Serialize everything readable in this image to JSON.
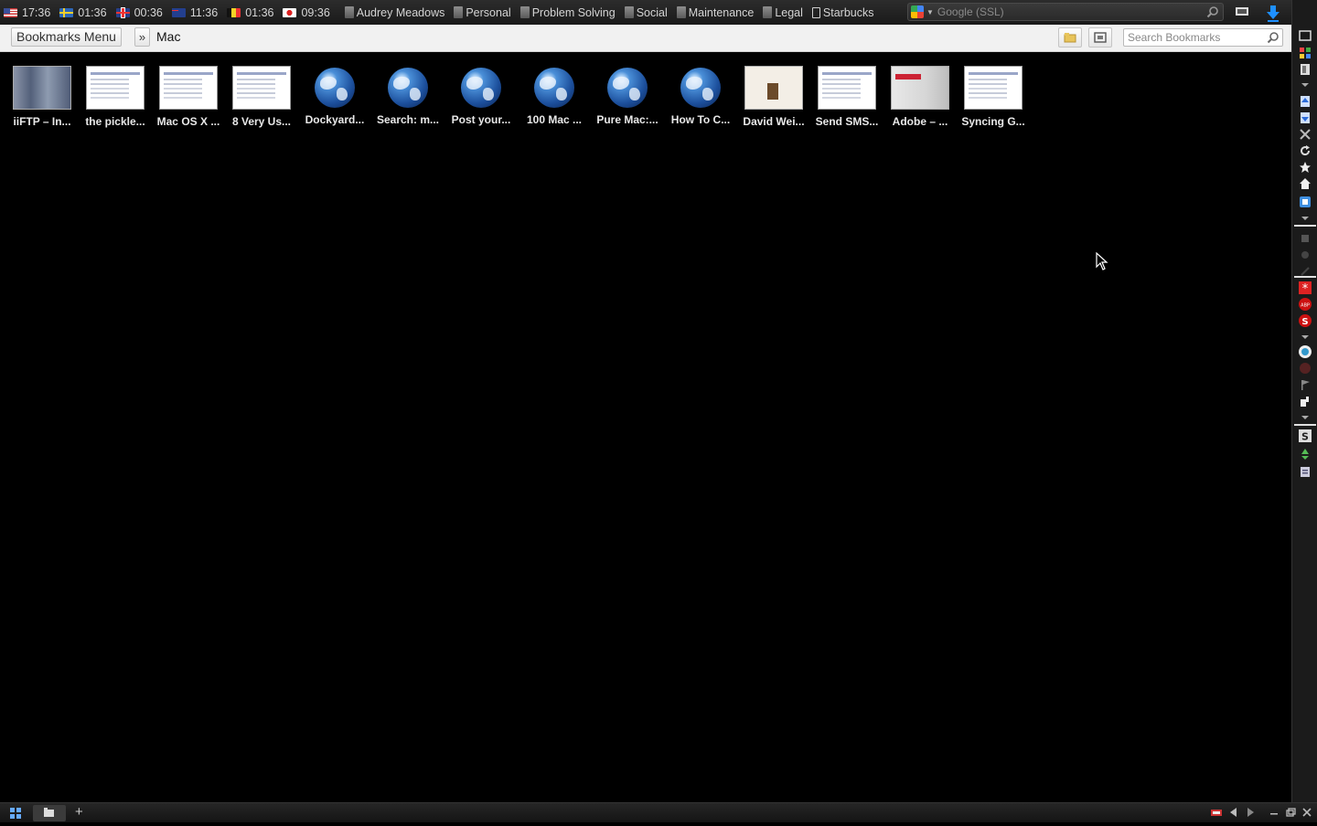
{
  "topbar": {
    "clocks": [
      {
        "flag": "us",
        "time": "17:36"
      },
      {
        "flag": "se",
        "time": "01:36"
      },
      {
        "flag": "uk",
        "time": "00:36"
      },
      {
        "flag": "au",
        "time": "11:36"
      },
      {
        "flag": "be",
        "time": "01:36"
      },
      {
        "flag": "jp",
        "time": "09:36"
      }
    ],
    "bookmarks": [
      "Audrey Meadows",
      "Personal",
      "Problem Solving",
      "Social",
      "Maintenance",
      "Legal",
      "Starbucks"
    ],
    "search_placeholder": "Google (SSL)"
  },
  "crumbbar": {
    "menu_label": "Bookmarks Menu",
    "separator": "»",
    "current": "Mac",
    "search_placeholder": "Search Bookmarks"
  },
  "tiles": [
    {
      "label": "iiFTP – In...",
      "kind": "dark"
    },
    {
      "label": "the pickle...",
      "kind": "page"
    },
    {
      "label": "Mac OS X ...",
      "kind": "page"
    },
    {
      "label": "8 Very Us...",
      "kind": "page"
    },
    {
      "label": "Dockyard...",
      "kind": "globe"
    },
    {
      "label": "Search: m...",
      "kind": "globe"
    },
    {
      "label": "Post your...",
      "kind": "globe"
    },
    {
      "label": "100 Mac ...",
      "kind": "globe"
    },
    {
      "label": "Pure Mac:...",
      "kind": "globe"
    },
    {
      "label": "How To C...",
      "kind": "globe"
    },
    {
      "label": "David Wei...",
      "kind": "david"
    },
    {
      "label": "Send SMS...",
      "kind": "page"
    },
    {
      "label": "Adobe – ...",
      "kind": "adobe"
    },
    {
      "label": "Syncing G...",
      "kind": "page"
    }
  ],
  "colors": {
    "background": "#000000",
    "crumbbar": "#f1f1f1",
    "accent_download": "#1e90ff"
  }
}
